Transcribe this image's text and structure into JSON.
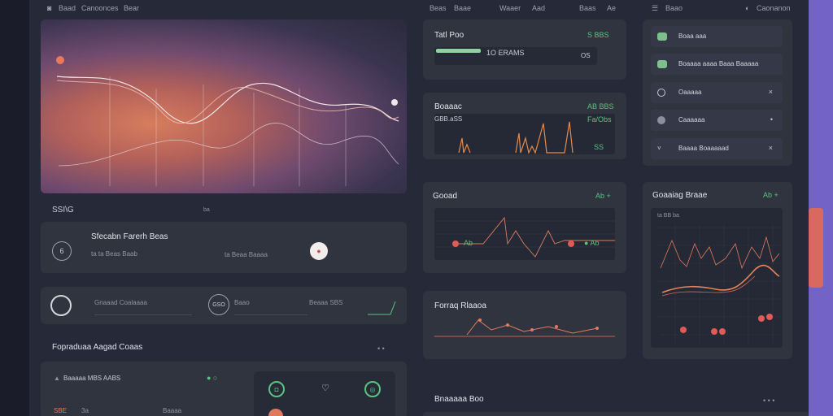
{
  "topbar": {
    "left1": "Baad",
    "left2": "Canoonces",
    "left3": "Bear",
    "mid1": "Beas",
    "mid2": "Baae",
    "mid3": "Waaer",
    "mid4": "Aad",
    "mid5": "Baas",
    "mid6": "Ae",
    "right1": "Baao",
    "right2": "Caonanon"
  },
  "hero": {
    "caption": "SSI\\G",
    "caption_right": "ba"
  },
  "station_card": {
    "title": "Sfecabn Farerh Beas",
    "subtitle": "ta ta Beas Baab",
    "mid": "ta Beaa Baaaa"
  },
  "control_strip": {
    "label1": "Gnaaad Coalaaaa",
    "label2": "GSO",
    "label3": "Baao",
    "label4": "Beaaa SBS"
  },
  "section": {
    "title": "Fopraduaa Aagad Coaas",
    "more": "• •"
  },
  "bottom_left": {
    "row1": "Baaaaa MBS AABS",
    "row2": "SBE",
    "row2b": "3a",
    "row2c": "Baaaa"
  },
  "total_card": {
    "title": "Tatl Poo",
    "value": "1O ERAMS",
    "right_top": "S BBS",
    "right_bottom": "OS",
    "progress": 0.55
  },
  "bars_card": {
    "title": "Boaaac",
    "sub": "GBB.aSS",
    "right_top": "AB BBS",
    "right_mid": "Fa/Obs",
    "right_bottom": "SS"
  },
  "good_card": {
    "title": "Gooad",
    "badge": "Ab +",
    "tag": "Ab"
  },
  "forecast_card": {
    "title": "Forraq Rlaaoa"
  },
  "bottom_mid": {
    "title": "Bnaaaaa Boo",
    "more": "• • •"
  },
  "list_card": {
    "items": [
      {
        "label": "Boaa aaa",
        "icon": "square-icon",
        "action": ""
      },
      {
        "label": "Boaaaa aaaa Baaa Baaaaa",
        "icon": "square-icon",
        "action": ""
      },
      {
        "label": "Oaaaaa",
        "icon": "circle-icon",
        "action": "×"
      },
      {
        "label": "Caaaaaa",
        "icon": "circle-icon",
        "action": "•"
      },
      {
        "label": "Baaaa Boaaaaad",
        "icon": "chevron-down-icon",
        "action": "×"
      }
    ]
  },
  "coding_card": {
    "title": "Goaaiag Braae",
    "badge": "Ab +",
    "legend": "ta BB ba"
  },
  "colors": {
    "accent": "#59c37f",
    "warm": "#e07a5f",
    "panel": "#30343f",
    "scroll": "#d9685e"
  }
}
